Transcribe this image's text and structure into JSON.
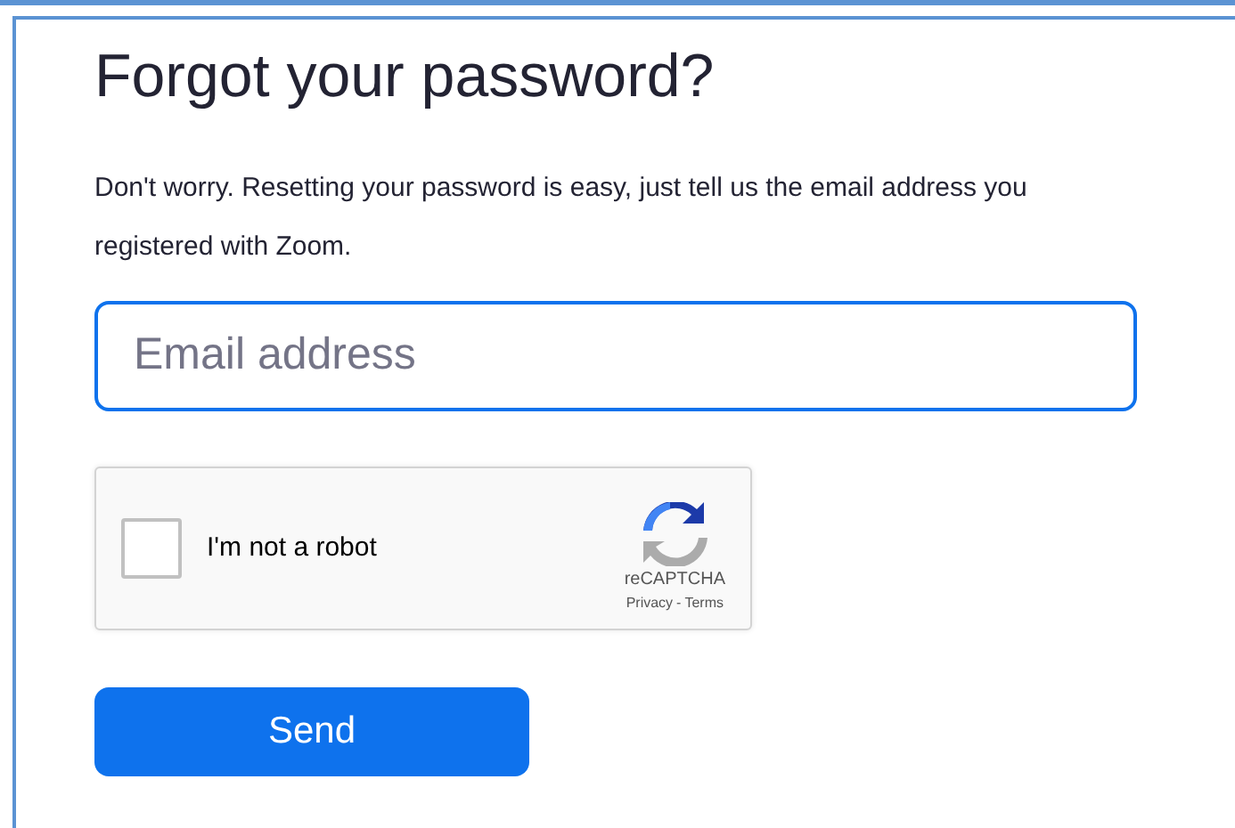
{
  "title": "Forgot your password?",
  "description": "Don't worry. Resetting your password is easy, just tell us the email address you registered with Zoom.",
  "email_field": {
    "placeholder": "Email address",
    "focused": true
  },
  "captcha": {
    "label": "I'm not a robot",
    "checked": false,
    "brand": "reCAPTCHA",
    "links": [
      "Privacy",
      "Terms"
    ],
    "separator": "-"
  },
  "buttons": [
    "Send"
  ]
}
